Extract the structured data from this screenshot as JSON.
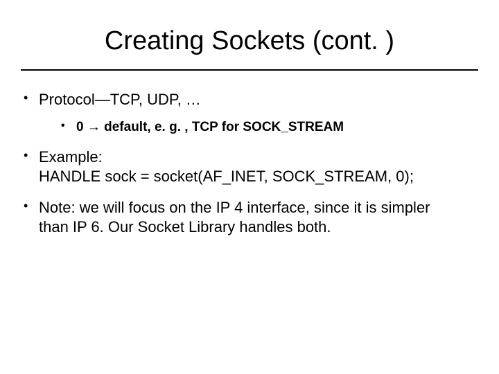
{
  "title": "Creating Sockets (cont. )",
  "bullets": {
    "b1": "Protocol—TCP, UDP, …",
    "b1a_pre": "0 ",
    "b1a_arrow": "→",
    "b1a_post": " default, e. g. , TCP for SOCK_STREAM",
    "b2_l1": "Example:",
    "b2_l2": "HANDLE sock = socket(AF_INET, SOCK_STREAM, 0);",
    "b3_l1": "Note: we will focus on the IP 4 interface, since it is simpler",
    "b3_l2": "than IP 6. Our Socket Library handles both."
  }
}
